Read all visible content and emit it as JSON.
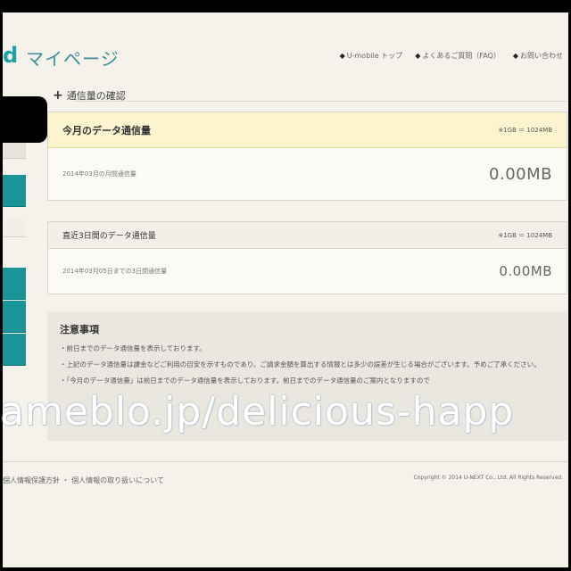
{
  "header": {
    "logo_tail": "d",
    "title": "マイページ",
    "nav": [
      {
        "mark": "◆",
        "label": "U-mobile トップ"
      },
      {
        "mark": "◆",
        "label": "よくあるご質問（FAQ）"
      },
      {
        "mark": "◆",
        "label": "お問い合わせ"
      }
    ]
  },
  "section": {
    "icon": "plus-icon",
    "title": "通信量の確認"
  },
  "current_month": {
    "title": "今月のデータ通信量",
    "unit_note": "※1GB ＝ 1024MB",
    "date_label": "2014年03月の月間通信量",
    "value": "0.00MB"
  },
  "recent": {
    "title": "直近3日間のデータ通信量",
    "unit_note": "※1GB ＝ 1024MB",
    "date_label": "2014年03月05日までの3日間通信量",
    "value": "0.00MB"
  },
  "notes": {
    "title": "注意事項",
    "items": [
      "・前日までのデータ通信量を表示しております。",
      "・上記のデータ通信量は課金などご利用の目安を示すものであり、ご請求金額を算出する情報とは多少の誤差が生じる場合がございます。予めご了承ください。",
      "・「今月のデータ通信量」は前日までのデータ通信量を表示しております。前日までのデータ通信量のご案内となりますので"
    ]
  },
  "watermark": "ameblo.jp/delicious-happ",
  "footer": {
    "left": "個人情報保護方針 ・ 個人情報の取り扱いについて",
    "right": "Copyright © 2014 U-NEXT Co., Ltd. All Rights Reserved."
  }
}
